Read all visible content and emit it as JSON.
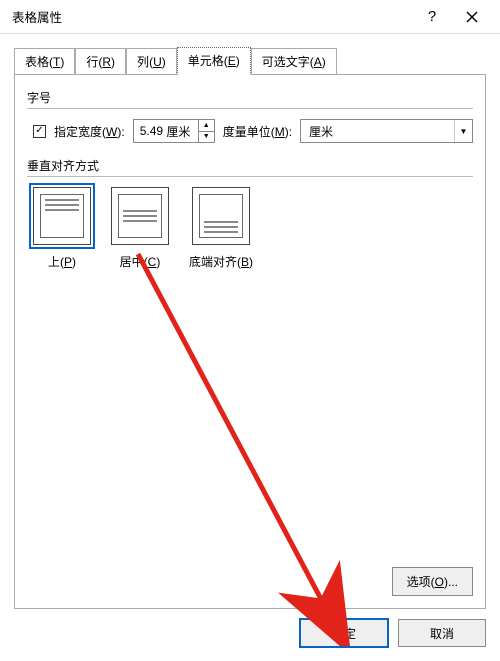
{
  "title": "表格属性",
  "tabs": [
    {
      "label": "表格",
      "key": "T"
    },
    {
      "label": "行",
      "key": "R"
    },
    {
      "label": "列",
      "key": "U"
    },
    {
      "label": "单元格",
      "key": "E"
    },
    {
      "label": "可选文字",
      "key": "A"
    }
  ],
  "active_tab": 3,
  "size": {
    "group_label": "字号",
    "check_label": "指定宽度",
    "check_key": "W",
    "checked": true,
    "value": "5.49",
    "unit_inline": "厘米",
    "measure_label": "度量单位",
    "measure_key": "M",
    "measure_value": "厘米"
  },
  "valign": {
    "group_label": "垂直对齐方式",
    "options": [
      {
        "id": "top",
        "label": "上",
        "key": "P"
      },
      {
        "id": "center",
        "label": "居中",
        "key": "C"
      },
      {
        "id": "bottom",
        "label": "底端对齐",
        "key": "B"
      }
    ],
    "selected": "top"
  },
  "options_button": {
    "label": "选项",
    "key": "O"
  },
  "footer": {
    "ok": "确定",
    "cancel": "取消"
  },
  "annotation_color": "#e2231a"
}
